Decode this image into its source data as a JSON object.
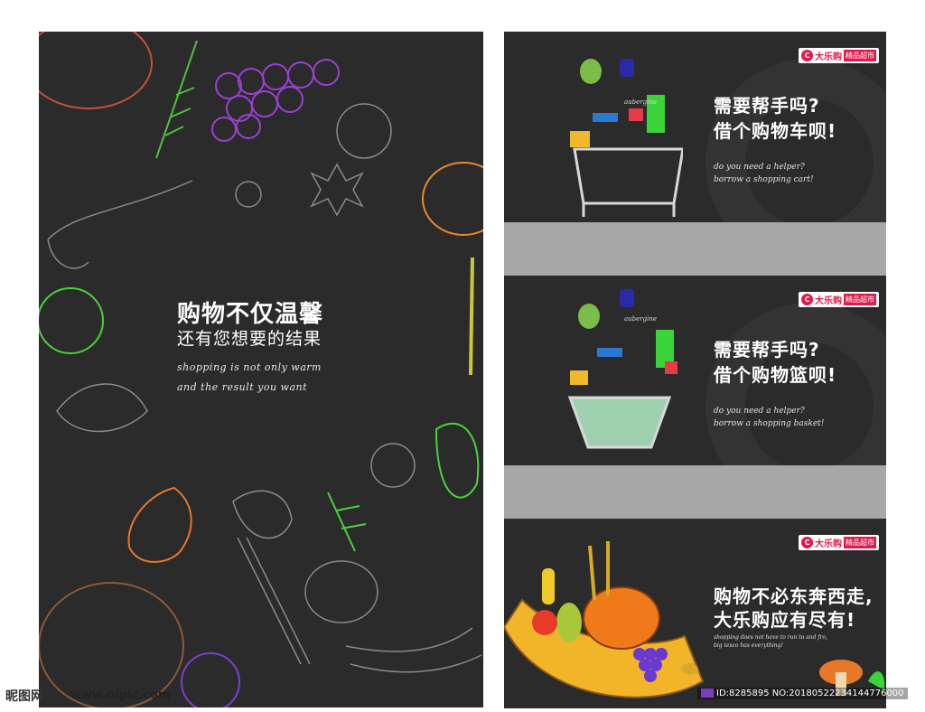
{
  "poster": {
    "title_line1": "购物不仅温馨",
    "title_line2": "还有您想要的结果",
    "en_line1": "shopping is not only warm",
    "en_line2": "and the result you want"
  },
  "panels": [
    {
      "logo_brand": "大乐购",
      "logo_tag": "精品超市",
      "heading_line1": "需要帮手吗?",
      "heading_line2": "借个购物车呗!",
      "en_line1": "do you need a helper?",
      "en_line2": "borrow a shopping cart!",
      "product_label": "aubergine"
    },
    {
      "logo_brand": "大乐购",
      "logo_tag": "精品超市",
      "heading_line1": "需要帮手吗?",
      "heading_line2": "借个购物篮呗!",
      "en_line1": "do you need a helper?",
      "en_line2": "borrow a shopping basket!",
      "product_label": "aubergine"
    },
    {
      "logo_brand": "大乐购",
      "logo_tag": "精品超市",
      "heading_line1": "购物不必东奔西走,",
      "heading_line2": "大乐购应有尽有!",
      "en_line1": "shopping does not have to run to and fro,",
      "en_line2": "big tesco has everything!"
    }
  ],
  "footer": {
    "site_logo": "昵图网",
    "site_url": "www.nipic.com",
    "image_id": "ID:8285895 NO:20180522234144776000"
  },
  "colors": {
    "background_dark": "#2b2b2b",
    "band_gray": "#a7a7a7",
    "brand_red": "#e6194b"
  }
}
